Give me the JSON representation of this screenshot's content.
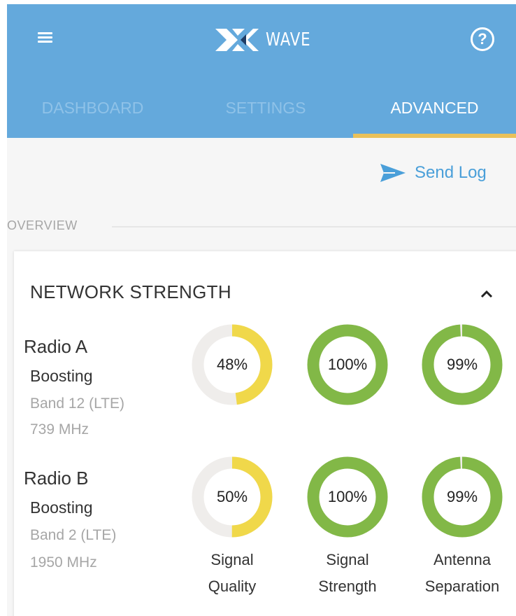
{
  "header": {
    "logo_text": "WAVE",
    "colors": {
      "bar": "#64a9dc",
      "tab_indicator": "#e9c15a"
    }
  },
  "tabs": [
    {
      "label": "DASHBOARD",
      "active": false
    },
    {
      "label": "SETTINGS",
      "active": false
    },
    {
      "label": "ADVANCED",
      "active": true
    }
  ],
  "actions": {
    "send_log_label": "Send Log"
  },
  "overview": {
    "section_label": "OVERVIEW",
    "card_title": "NETWORK STRENGTH",
    "radios": [
      {
        "name": "Radio A",
        "status": "Boosting",
        "band": "Band 12 (LTE)",
        "frequency": "739 MHz",
        "metrics": [
          {
            "label": "48%",
            "value": 48,
            "color": "#f0d84a"
          },
          {
            "label": "100%",
            "value": 100,
            "color": "#82b847"
          },
          {
            "label": "99%",
            "value": 99,
            "color": "#82b847"
          }
        ]
      },
      {
        "name": "Radio B",
        "status": "Boosting",
        "band": "Band 2 (LTE)",
        "frequency": "1950 MHz",
        "metrics": [
          {
            "label": "50%",
            "value": 50,
            "color": "#f0d84a"
          },
          {
            "label": "100%",
            "value": 100,
            "color": "#82b847"
          },
          {
            "label": "99%",
            "value": 99,
            "color": "#82b847"
          }
        ]
      }
    ],
    "columns": [
      {
        "line1": "Signal",
        "line2": "Quality"
      },
      {
        "line1": "Signal",
        "line2": "Strength"
      },
      {
        "line1": "Antenna",
        "line2": "Separation"
      }
    ],
    "track_color": "#efedeb"
  },
  "icons": {
    "menu": "hamburger-menu-icon",
    "help": "help-circle-icon",
    "send": "paper-plane-icon",
    "collapse": "chevron-up-icon"
  }
}
